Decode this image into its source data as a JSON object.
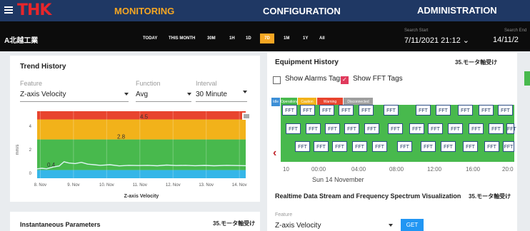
{
  "nav": {
    "logo": "THK",
    "monitoring": "MONITORING",
    "configuration": "CONFIGURATION",
    "administration": "ADMINISTRATION"
  },
  "subbar": {
    "plant": "A北越工業",
    "ranges": [
      "TODAY",
      "THIS MONTH",
      "30M",
      "1H",
      "1D",
      "7D",
      "1M",
      "1Y",
      "All"
    ],
    "active_range": "7D",
    "search_start_label": "Search Start",
    "search_start_value": "7/11/2021 21:12",
    "search_end_label": "Search End",
    "search_end_value": "14/11/2"
  },
  "trend": {
    "title": "Trend History",
    "feature_label": "Feature",
    "feature_value": "Z-axis Velocity",
    "function_label": "Function",
    "function_value": "Avg",
    "interval_label": "Interval",
    "interval_value": "30 Minute"
  },
  "chart_data": {
    "type": "line",
    "title": "",
    "xlabel": "Z-axis Velocity",
    "ylabel": "mm/s",
    "x_ticks": [
      "8. Nov",
      "9. Nov",
      "10. Nov",
      "11. Nov",
      "12. Nov",
      "13. Nov",
      "14. Nov"
    ],
    "y_ticks": [
      0,
      2,
      4
    ],
    "ylim": [
      -0.5,
      5.2
    ],
    "bands": [
      {
        "from": -0.5,
        "to": 0.2,
        "color": "#35b6e8"
      },
      {
        "from": 0.2,
        "to": 2.8,
        "color": "#48b94d"
      },
      {
        "from": 2.8,
        "to": 4.5,
        "color": "#f2b21a"
      },
      {
        "from": 4.5,
        "to": 5.2,
        "color": "#e8442e"
      }
    ],
    "threshold_labels": [
      "4.5",
      "2.8",
      "0.4"
    ],
    "series": [
      {
        "x": [
          0,
          0.15,
          0.3,
          0.5,
          0.7,
          0.85,
          1.0,
          1.2,
          1.4,
          1.6,
          1.8,
          2.0,
          2.3,
          2.6,
          2.9,
          3.2,
          3.5,
          3.8,
          4.1,
          4.4,
          4.7,
          5.0,
          5.3,
          5.6,
          6.0,
          6.3,
          6.6
        ],
        "values": [
          0.3,
          0.35,
          0.3,
          0.45,
          0.55,
          0.9,
          0.8,
          0.75,
          0.85,
          0.7,
          0.65,
          0.6,
          0.65,
          0.55,
          0.6,
          0.58,
          0.6,
          0.56,
          0.62,
          0.58,
          0.6,
          0.57,
          0.59,
          0.56,
          0.6,
          0.58,
          0.57
        ]
      }
    ],
    "line_color": "#dff5f5",
    "grid": true
  },
  "instant": {
    "title": "Instantaneous Parameters",
    "tag": "35.モータ軸受け"
  },
  "equipment": {
    "title": "Equipment History",
    "tag": "35.モータ軸受け",
    "show_alarms_label": "Show Alarms Tags",
    "show_alarms_checked": false,
    "show_fft_label": "Show FFT Tags",
    "show_fft_checked": true,
    "legend": [
      {
        "label": "Idle",
        "color": "#3c8fd6"
      },
      {
        "label": "Operational",
        "color": "#48b94d"
      },
      {
        "label": "Caution",
        "color": "#f2b21a"
      },
      {
        "label": "Warning",
        "color": "#e8442e"
      },
      {
        "label": "Disconnected",
        "color": "#9e9e9e"
      }
    ],
    "fft_label": "FFT",
    "timeline_ticks": [
      "10",
      "00:00",
      "04:00",
      "08:00",
      "12:00",
      "16:00",
      "20:0"
    ],
    "date_label": "Sun 14 November"
  },
  "realtime": {
    "title": "Realtime Data Stream and Frequency Spectrum Visualization",
    "tag": "35.モータ軸受け",
    "feature_label": "Feature",
    "feature_value": "Z-axis Velocity",
    "get_label": "GET"
  },
  "colors": {
    "nav_bg": "#1f3864",
    "accent": "#f5a623",
    "logo": "#e8262b"
  }
}
